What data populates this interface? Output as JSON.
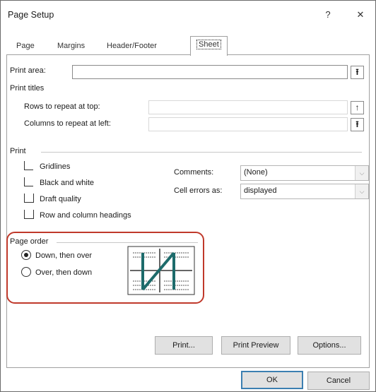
{
  "dialog": {
    "title": "Page Setup",
    "help_glyph": "?",
    "close_glyph": "✕"
  },
  "tabs": [
    {
      "label": "Page",
      "active": false
    },
    {
      "label": "Margins",
      "active": false
    },
    {
      "label": "Header/Footer",
      "active": false
    },
    {
      "label": "Sheet",
      "active": true
    }
  ],
  "sheet": {
    "print_area": {
      "label": "Print area:",
      "value": "",
      "picker_glyph": "⭱"
    },
    "print_titles": {
      "header": "Print titles",
      "rows_label": "Rows to repeat at top:",
      "rows_value": "",
      "rows_picker_glyph": "↑",
      "cols_label": "Columns to repeat at left:",
      "cols_value": "",
      "cols_picker_glyph": "⭱"
    },
    "print": {
      "header": "Print",
      "gridlines": {
        "label": "Gridlines",
        "checked": false
      },
      "black_white": {
        "label": "Black and white",
        "checked": false
      },
      "draft": {
        "label": "Draft quality",
        "checked": false
      },
      "row_col_headings": {
        "label": "Row and column headings",
        "checked": false
      },
      "comments_label": "Comments:",
      "comments_value": "(None)",
      "cell_errors_label": "Cell errors as:",
      "cell_errors_value": "displayed"
    },
    "page_order": {
      "header": "Page order",
      "down_then_over": {
        "label": "Down, then over",
        "selected": true
      },
      "over_then_down": {
        "label": "Over, then down",
        "selected": false
      }
    }
  },
  "actions": {
    "print": "Print...",
    "print_preview": "Print Preview",
    "options": "Options...",
    "ok": "OK",
    "cancel": "Cancel"
  },
  "colors": {
    "highlight": "#c0392b",
    "default_button_border": "#3c7fb1"
  }
}
